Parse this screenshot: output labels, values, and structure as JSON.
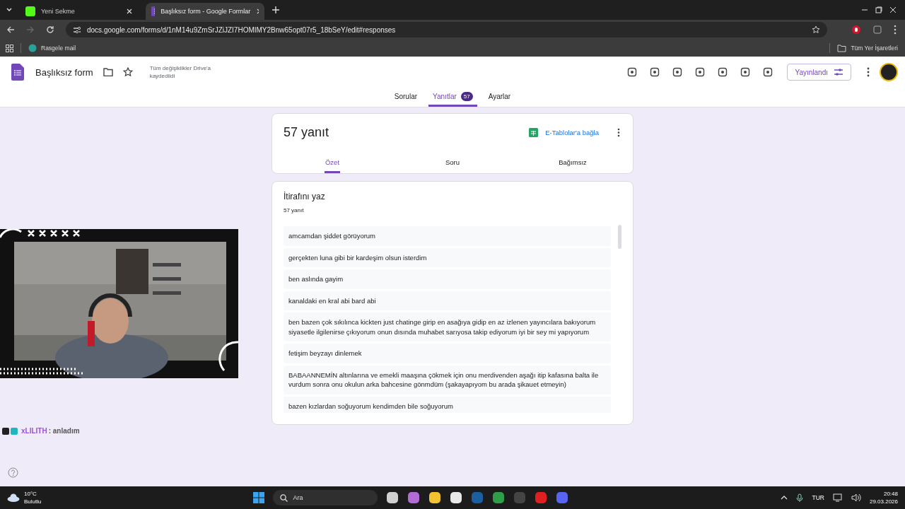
{
  "browser": {
    "tabs": [
      {
        "title": "Yeni Sekme",
        "selected": false
      },
      {
        "title": "Başlıksız form - Google Formlar",
        "selected": true
      }
    ],
    "url": "docs.google.com/forms/d/1nM14u9ZmSrJZiJZI7HOMIMY2Bnw65opt07r5_18bSeY/edit#responses",
    "bookmarks": [
      "Rasgele mail"
    ],
    "all_bookmarks": "Tüm Yer İşaretleri"
  },
  "form_header": {
    "title": "Başlıksız form",
    "save_status": "Tüm değişiklikler Drive'a kaydedildi",
    "publish_button": "Yayınlandı"
  },
  "form_tabs": [
    {
      "label": "Sorular",
      "selected": false
    },
    {
      "label": "Yanıtlar",
      "badge": "57",
      "selected": true
    },
    {
      "label": "Ayarlar",
      "selected": false
    }
  ],
  "summary_card": {
    "count": "57 yanıt",
    "sheets_link": "E-Tablolar'a bağla",
    "views": [
      {
        "label": "Özet",
        "selected": true
      },
      {
        "label": "Soru",
        "selected": false
      },
      {
        "label": "Bağımsız",
        "selected": false
      }
    ]
  },
  "question_card": {
    "title": "İtirafını yaz",
    "count": "57 yanıt",
    "answers": [
      "amcamdan şiddet görüyorum",
      "gerçekten luna gibi bir kardeşim olsun isterdim",
      "ben aslında gayim",
      "kanaldaki en kral abi bard abi",
      "ben bazen çok sıkılınca kickten just chatinge girip en asağıya gidip en az izlenen yayıncılara bakıyorum siyasetle ilgilenirse çıkıyorum onun dısında muhabet sarıyosa takip ediyorum iyi bir sey mi yapıyorum",
      "fetişim beyzayı dinlemek",
      "BABAANNEMİN altınlarına ve emekli maaşına çökmek için onu merdivenden aşağı itip kafasına balta ile vurdum sonra onu okulun arka bahcesine gönmdüm (şakayapıyom bu arada şikauet etmeyin)",
      "bazen kızlardan soğuyorum kendimden bile soğuyorum"
    ]
  },
  "chat": {
    "user": "xLILITH",
    "message": ": anladım"
  },
  "taskbar": {
    "weather": {
      "temperature": "10°C",
      "condition": "Bulutlu"
    },
    "search": {
      "placeholder": "Ara"
    },
    "language": "TUR",
    "time": "20:48",
    "date": "29.03.2026"
  }
}
